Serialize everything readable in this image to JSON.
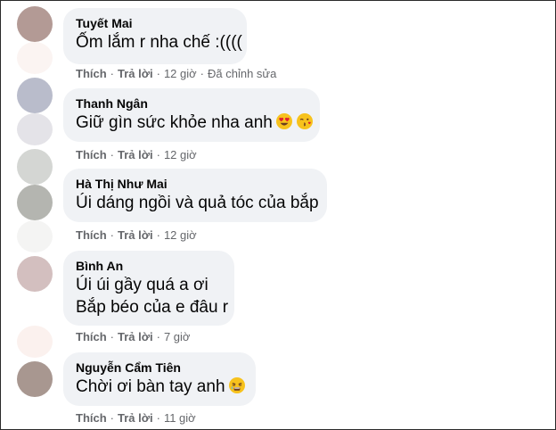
{
  "actions": {
    "like": "Thích",
    "reply": "Trả lời",
    "separator": "·"
  },
  "comments": [
    {
      "author": "Tuyết Mai",
      "lines": [
        "Ốm lắm r nha chế :(((("
      ],
      "time": "12 giờ",
      "edited": "Đã chỉnh sửa",
      "avatar_color": "#b39a95",
      "emojis": []
    },
    {
      "author": "Thanh Ngân",
      "lines": [
        "Giữ gìn sức khỏe nha anh"
      ],
      "time": "12 giờ",
      "edited": "",
      "avatar_color": "#b9bccb",
      "emojis": [
        "heart-eyes-emoji",
        "kissing-emoji"
      ]
    },
    {
      "author": "Hà Thị Như Mai",
      "lines": [
        "Úi dáng ngồi và quả tóc của bắp"
      ],
      "time": "12 giờ",
      "edited": "",
      "avatar_color": "#b4b5b0",
      "emojis": []
    },
    {
      "author": "Bình An",
      "lines": [
        "Úi úi gầy quá a ơi",
        "Bắp béo của e đâu r"
      ],
      "time": "7 giờ",
      "edited": "",
      "avatar_color": "#d3bfbf",
      "emojis": []
    },
    {
      "author": "Nguyễn Cẩm Tiên",
      "lines": [
        "Chời ơi bàn tay anh"
      ],
      "time": "11 giờ",
      "edited": "",
      "avatar_color": "#a89790",
      "emojis": [
        "crying-emoji"
      ]
    }
  ]
}
